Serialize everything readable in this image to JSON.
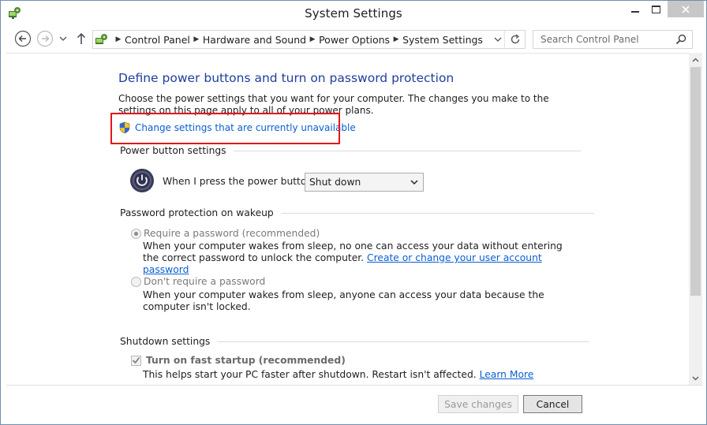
{
  "window": {
    "title": "System Settings"
  },
  "nav": {
    "breadcrumb": [
      "Control Panel",
      "Hardware and Sound",
      "Power Options",
      "System Settings"
    ],
    "search_placeholder": "Search Control Panel"
  },
  "content": {
    "heading": "Define power buttons and turn on password protection",
    "description": "Choose the power settings that you want for your computer. The changes you make to the settings on this page apply to all of your power plans.",
    "uac_link": "Change settings that are currently unavailable",
    "power_section": {
      "title": "Power button settings",
      "label": "When I press the power button:",
      "selected": "Shut down"
    },
    "password_section": {
      "title": "Password protection on wakeup",
      "require_label": "Require a password (recommended)",
      "require_help": "When your computer wakes from sleep, no one can access your data without entering the correct password to unlock the computer.",
      "require_link": "Create or change your user account password",
      "norequire_label": "Don't require a password",
      "norequire_help": "When your computer wakes from sleep, anyone can access your data because the computer isn't locked."
    },
    "shutdown_section": {
      "title": "Shutdown settings",
      "fast_startup_label": "Turn on fast startup (recommended)",
      "fast_startup_help": "This helps start your PC faster after shutdown. Restart isn't affected.",
      "learn_more": "Learn More"
    }
  },
  "footer": {
    "save_label": "Save changes",
    "cancel_label": "Cancel"
  },
  "colors": {
    "heading": "#1e3e9d",
    "link": "#0b5ed1",
    "highlight": "#e4141b"
  }
}
